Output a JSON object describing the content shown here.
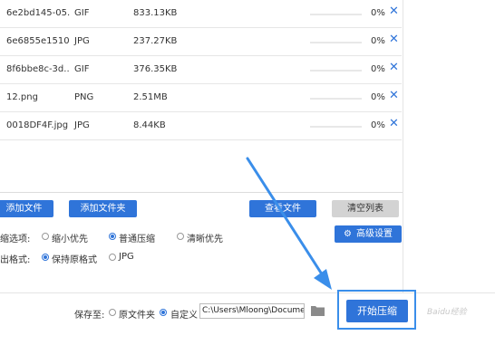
{
  "files": [
    {
      "name": "6e2bd145-05...",
      "type": "GIF",
      "size": "833.13KB",
      "progress": "0%",
      "progress_value": 0
    },
    {
      "name": "6e6855e1510...",
      "type": "JPG",
      "size": "237.27KB",
      "progress": "0%",
      "progress_value": 0
    },
    {
      "name": "8f6bbe8c-3d...",
      "type": "GIF",
      "size": "376.35KB",
      "progress": "0%",
      "progress_value": 0
    },
    {
      "name": "12.png",
      "type": "PNG",
      "size": "2.51MB",
      "progress": "0%",
      "progress_value": 0
    },
    {
      "name": "0018DF4F.jpg",
      "type": "JPG",
      "size": "8.44KB",
      "progress": "0%",
      "progress_value": 0
    }
  ],
  "remove_glyph": "✕",
  "toolbar": {
    "add_file": "添加文件",
    "add_folder": "添加文件夹",
    "query_file": "查看文件",
    "clear_list": "清空列表"
  },
  "compress": {
    "label": "缩选项:",
    "options": [
      "缩小优先",
      "普通压缩",
      "清晰优先"
    ],
    "selected": "普通压缩",
    "advanced": "高级设置"
  },
  "format": {
    "label": "出格式:",
    "options": [
      "保持原格式",
      "JPG"
    ],
    "selected": "保持原格式"
  },
  "save": {
    "label": "保存至:",
    "options": [
      "原文件夹",
      "自定义"
    ],
    "selected": "自定义",
    "path": "C:\\Users\\Mloong\\Docume"
  },
  "start_label": "开始压缩",
  "watermark": "Baidu经验",
  "colors": {
    "accent": "#2f74d9",
    "highlight": "#3a8eea",
    "gray_button": "#d3d3d3"
  }
}
